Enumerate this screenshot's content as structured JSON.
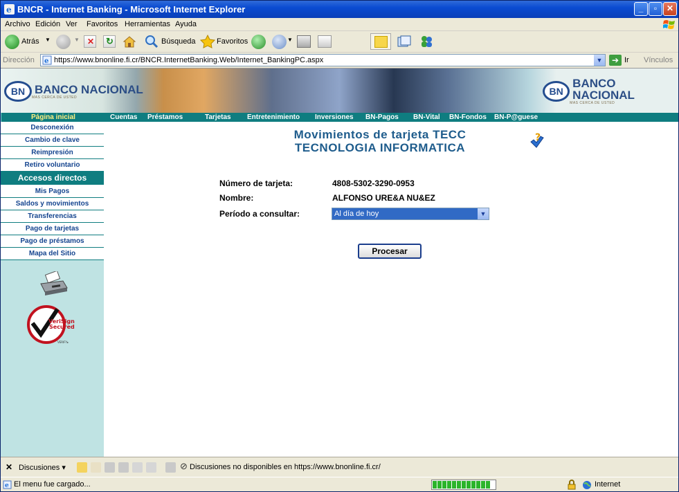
{
  "window": {
    "title": "BNCR - Internet Banking - Microsoft Internet Explorer"
  },
  "menu": [
    "Archivo",
    "Edición",
    "Ver",
    "Favoritos",
    "Herramientas",
    "Ayuda"
  ],
  "toolbar": {
    "back_label": "Atrás",
    "search_label": "Búsqueda",
    "favorites_label": "Favoritos"
  },
  "address": {
    "label": "Dirección",
    "url": "https://www.bnonline.fi.cr/BNCR.InternetBanking.Web/Internet_BankingPC.aspx",
    "go_label": "Ir",
    "links_label": "Vínculos"
  },
  "banner": {
    "logo_text": "BANCO NACIONAL",
    "logo_tagline": "MAS CERCA DE USTED"
  },
  "nav": [
    "Página inicial",
    "Cuentas",
    "Préstamos",
    "Tarjetas",
    "Entretenimiento",
    "Inversiones",
    "BN-Pagos",
    "BN-Vital",
    "BN-Fondos",
    "BN-P@guese"
  ],
  "sidebar": {
    "items": [
      "Desconexión",
      "Cambio de clave",
      "Reimpresión",
      "Retiro voluntario"
    ],
    "section_title": "Accesos directos",
    "shortcuts": [
      "Mis Pagos",
      "Saldos y movimientos",
      "Transferencias",
      "Pago de tarjetas",
      "Pago de préstamos",
      "Mapa del Sitio"
    ]
  },
  "verisign": {
    "line1": "VeriSign",
    "line2": "Secured",
    "verify": "VERIFY▸"
  },
  "main": {
    "title_line1": "Movimientos de tarjeta TECC",
    "title_line2": "TECNOLOGIA INFORMATICA",
    "card_label": "Número de tarjeta:",
    "card_value": "4808-5302-3290-0953",
    "name_label": "Nombre:",
    "name_value": "ALFONSO URE&A NU&EZ",
    "period_label": "Período a consultar:",
    "period_value": "Al día de hoy",
    "process_button": "Procesar"
  },
  "discussions": {
    "label": "Discusiones",
    "message": "Discusiones no disponibles en https://www.bnonline.fi.cr/"
  },
  "status": {
    "text": "El menu fue cargado...",
    "zone": "Internet"
  }
}
